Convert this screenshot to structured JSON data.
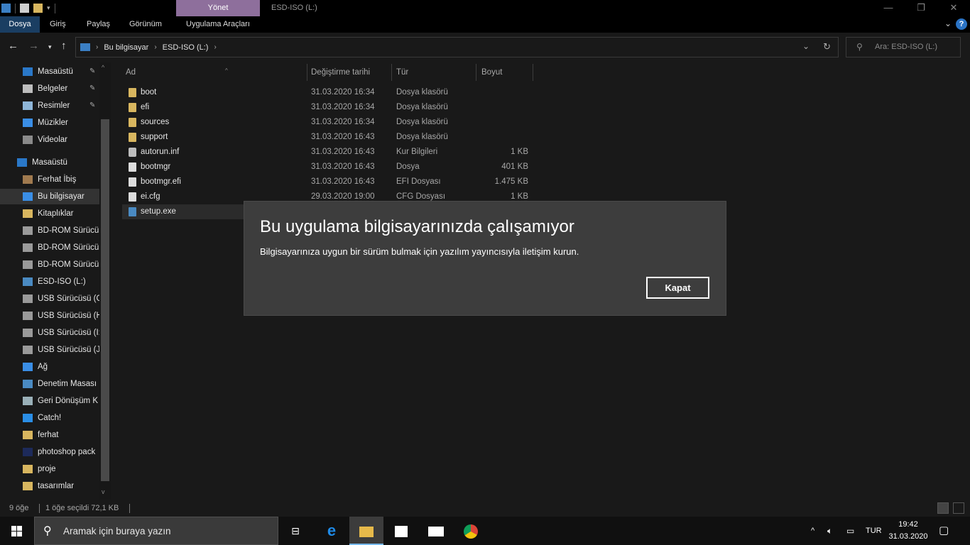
{
  "titlebar": {
    "manage_tab": "Yönet",
    "window_title": "ESD-ISO (L:)",
    "minimize": "—",
    "maximize": "❐",
    "close": "✕"
  },
  "ribbon": {
    "tabs": [
      "Dosya",
      "Giriş",
      "Paylaş",
      "Görünüm",
      "Uygulama Araçları"
    ],
    "collapse": "⌄",
    "help": "?"
  },
  "address": {
    "crumbs": [
      "Bu bilgisayar",
      "ESD-ISO (L:)"
    ],
    "search_placeholder": "Ara: ESD-ISO (L:)"
  },
  "sidebar": {
    "items": [
      {
        "label": "Masaüstü",
        "icon": "desktop-icon",
        "pinned": true
      },
      {
        "label": "Belgeler",
        "icon": "documents-icon",
        "pinned": true
      },
      {
        "label": "Resimler",
        "icon": "pictures-icon",
        "pinned": true
      },
      {
        "label": "Müzikler",
        "icon": "music-icon",
        "pinned": false
      },
      {
        "label": "Videolar",
        "icon": "videos-icon",
        "pinned": false
      },
      {
        "label": "Masaüstü",
        "icon": "desktop-icon",
        "pinned": false
      },
      {
        "label": "Ferhat İbiş",
        "icon": "user-icon",
        "pinned": false
      },
      {
        "label": "Bu bilgisayar",
        "icon": "computer-icon",
        "pinned": false,
        "selected": true
      },
      {
        "label": "Kitaplıklar",
        "icon": "libraries-icon",
        "pinned": false
      },
      {
        "label": "BD-ROM Sürücü",
        "icon": "optical-drive-icon",
        "pinned": false
      },
      {
        "label": "BD-ROM Sürücü",
        "icon": "optical-drive-icon",
        "pinned": false
      },
      {
        "label": "BD-ROM Sürücü",
        "icon": "optical-drive-icon",
        "pinned": false
      },
      {
        "label": "ESD-ISO (L:)",
        "icon": "iso-drive-icon",
        "pinned": false
      },
      {
        "label": "USB Sürücüsü (G",
        "icon": "usb-drive-icon",
        "pinned": false
      },
      {
        "label": "USB Sürücüsü (H",
        "icon": "usb-drive-icon",
        "pinned": false
      },
      {
        "label": "USB Sürücüsü (I:",
        "icon": "usb-drive-icon",
        "pinned": false
      },
      {
        "label": "USB Sürücüsü (J:",
        "icon": "usb-drive-icon",
        "pinned": false
      },
      {
        "label": "Ağ",
        "icon": "network-icon",
        "pinned": false
      },
      {
        "label": "Denetim Masası",
        "icon": "control-panel-icon",
        "pinned": false
      },
      {
        "label": "Geri Dönüşüm K",
        "icon": "recycle-bin-icon",
        "pinned": false
      },
      {
        "label": "Catch!",
        "icon": "catch-app-icon",
        "pinned": false
      },
      {
        "label": "ferhat",
        "icon": "folder-icon",
        "pinned": false
      },
      {
        "label": "photoshop pack",
        "icon": "photoshop-icon",
        "pinned": false
      },
      {
        "label": "proje",
        "icon": "folder-icon",
        "pinned": false
      },
      {
        "label": "tasarımlar",
        "icon": "folder-icon",
        "pinned": false
      }
    ]
  },
  "filelist": {
    "columns": [
      "Ad",
      "Değiştirme tarihi",
      "Tür",
      "Boyut"
    ],
    "rows": [
      {
        "name": "boot",
        "date": "31.03.2020 16:34",
        "type": "Dosya klasörü",
        "size": "",
        "kind": "folder"
      },
      {
        "name": "efi",
        "date": "31.03.2020 16:34",
        "type": "Dosya klasörü",
        "size": "",
        "kind": "folder"
      },
      {
        "name": "sources",
        "date": "31.03.2020 16:34",
        "type": "Dosya klasörü",
        "size": "",
        "kind": "folder"
      },
      {
        "name": "support",
        "date": "31.03.2020 16:43",
        "type": "Dosya klasörü",
        "size": "",
        "kind": "folder"
      },
      {
        "name": "autorun.inf",
        "date": "31.03.2020 16:43",
        "type": "Kur Bilgileri",
        "size": "1 KB",
        "kind": "settings"
      },
      {
        "name": "bootmgr",
        "date": "31.03.2020 16:43",
        "type": "Dosya",
        "size": "401 KB",
        "kind": "file"
      },
      {
        "name": "bootmgr.efi",
        "date": "31.03.2020 16:43",
        "type": "EFI Dosyası",
        "size": "1.475 KB",
        "kind": "file"
      },
      {
        "name": "ei.cfg",
        "date": "29.03.2020 19:00",
        "type": "CFG Dosyası",
        "size": "1 KB",
        "kind": "file"
      },
      {
        "name": "setup.exe",
        "date": "",
        "type": "",
        "size": "",
        "kind": "exe",
        "selected": true
      }
    ]
  },
  "dialog": {
    "title": "Bu uygulama bilgisayarınızda çalışamıyor",
    "message": "Bilgisayarınıza uygun bir sürüm bulmak için yazılım yayıncısıyla iletişim kurun.",
    "button": "Kapat"
  },
  "statusbar": {
    "item_count": "9 öğe",
    "selection": "1 öğe seçildi  72,1 KB"
  },
  "taskbar": {
    "search_placeholder": "Aramak için buraya yazın",
    "language": "TUR",
    "time": "19:42",
    "date": "31.03.2020"
  },
  "colors": {
    "background": "#191919",
    "dialog_bg": "#3d3d3d",
    "file_tab": "#1a3e62",
    "manage_tab": "#8e6f9c",
    "folder": "#d8b65f",
    "taskbar": "#101010"
  }
}
